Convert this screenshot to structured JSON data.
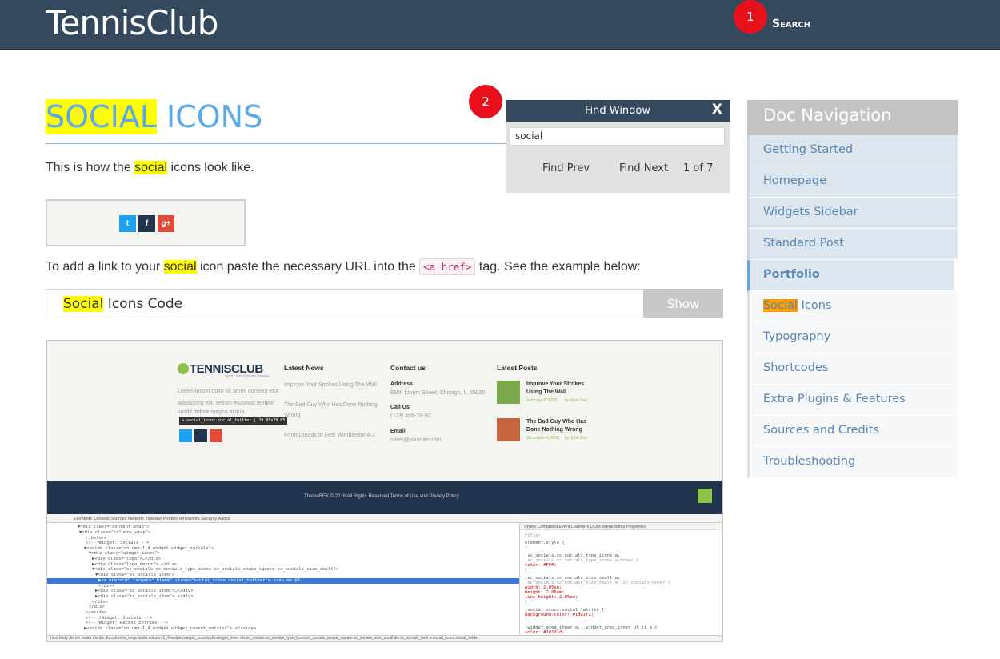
{
  "header": {
    "logo": "TennisClub",
    "search_label": "Search",
    "marker_1": "1",
    "marker_2": "2"
  },
  "content": {
    "title_highlight": "SOCIAL",
    "title_rest": " ICONS",
    "intro_before": "This is how the ",
    "intro_highlight": "social",
    "intro_after": " icons look like.",
    "para_before": "To add a link to your ",
    "para_highlight": "social",
    "para_middle": " icon paste the necessary URL into the ",
    "para_code": "<a href>",
    "para_after": " tag. See the example below:",
    "code_bar_highlight": "Social",
    "code_bar_rest": " Icons Code",
    "show_button": "Show"
  },
  "find_window": {
    "title": "Find Window",
    "close": "X",
    "query": "social",
    "prev": "Find Prev",
    "next": "Find Next",
    "count": "1 of 7"
  },
  "doc_nav": {
    "title": "Doc Navigation",
    "items": [
      {
        "label": "Getting Started"
      },
      {
        "label": "Homepage"
      },
      {
        "label": "Widgets Sidebar"
      },
      {
        "label": "Standard Post"
      },
      {
        "label": "Portfolio"
      },
      {
        "label_highlight": "Social",
        "label_rest": " Icons"
      },
      {
        "label": "Typography"
      },
      {
        "label": "Shortcodes"
      },
      {
        "label": "Extra Plugins & Features"
      },
      {
        "label": "Sources and Credits"
      },
      {
        "label": "Troubleshooting"
      }
    ]
  },
  "social_icons": {
    "twitter": "t",
    "facebook": "f",
    "google": "g+",
    "colors": {
      "twitter": "#1da1f2",
      "facebook": "#23344f",
      "google": "#e24a3a"
    }
  },
  "screenshot": {
    "logo": "TENNISCLUB",
    "logo_sub": "sport wordpress theme",
    "lorem": [
      "Lorem ipsum dolor sit amet, consect etur",
      "adipisicing elit, sed do eiusmod tempor",
      "incidit dolore magna aliqua."
    ],
    "tooltip": "a.social_icons.social_twitter | 29.05×29.05",
    "latest_news_title": "Latest News",
    "latest_news": [
      "Improve Your Strokes Using The Wall",
      "The Bad Guy Who Has Done Nothing",
      "Wrong",
      "From Dreads to Fed: Wimbledon A-Z"
    ],
    "contact_title": "Contact us",
    "address_label": "Address",
    "address": "8500 Lorem Street, Chicago, IL 55030",
    "call_label": "Call Us",
    "phone": "(123) 456-78-90",
    "email_label": "Email",
    "email": "sales@yoursite.com",
    "latest_posts_title": "Latest Posts",
    "post1_title": [
      "Improve Your Strokes",
      "Using The Wall"
    ],
    "post1_meta": "February 6, 2016",
    "post1_author": "by John Doe",
    "post2_title": [
      "The Bad Guy Who Has",
      "Done Nothing Wrong"
    ],
    "post2_meta": "December 4, 2015",
    "post2_author": "by John Doe",
    "footer_text": "ThemeREX © 2016 All Rights Reserved Terms of Use and Privacy Policy",
    "devtools_tabs": "Elements  Console  Sources  Network  Timeline  Profiles  Resources  Security  Audits",
    "devtools_lines": [
      "▼<div class=\"content_wrap\">",
      "▼<div class=\"columns_wrap\">",
      "::before",
      "<!-- Widget: Socials -->",
      "▼<aside class=\"column-1_4 widget widget_socials\">",
      "▼<div class=\"widget_inner\">",
      "▶<div class=\"logo\">…</div>",
      "▶<div class=\"logo_descr\">…</div>",
      "▼<div class=\"sc_socials sc_socials_type_icons sc_socials_shape_square sc_socials_size_small\">",
      "▼<div class=\"sc_socials_item\">",
      "▶<a href=\"#\" target=\"_blank\" class=\"social_icons social_twitter\">…</a> == $0",
      "</div>",
      "▶<div class=\"sc_socials_item\">…</div>",
      "▶<div class=\"sc_socials_item\">…</div>",
      "</div>",
      "</div>",
      "</aside>",
      "<!-- /Widget: Socials -->",
      "<!-- Widget: Recent Entries -->",
      "▶<aside class=\"column-1_4 widget widget_recent_entries\">…</aside>",
      "<!-- /Widget: Recent Entries -->"
    ],
    "styles_tabs": "Styles  Computed  Event Listeners  DOM Breakpoints  Properties",
    "styles_lines": [
      "Filter",
      "element.style {",
      "}",
      ".sc_socials.sc_socials_type_icons a,",
      ".sc_socials.sc_socials_type_icons a:hover {",
      "  color: #FFF;",
      "}",
      ".sc_socials.sc_socials_size_small a,",
      ".sc_socials.sc_socials_size_small a .sc_socials_hover {",
      "  width: 2.05em;",
      "  height: 2.05em;",
      "  line-height: 2.05em;",
      "}",
      ".social_icons.social_twitter {",
      "  background-color: #1da1f2;",
      "}",
      ".widget_area_inner a, .widget_area_inner ul li a {",
      "  color: #1d1d1d;"
    ],
    "breadcrumb": "html  body  div  div  footer  div  div  div.columns_wrap  aside.column-1_4.widget.widget_socials  div.widget_inner  div.sc_socials.sc_socials_type_icons.sc_socials_shape_square.sc_socials_size_small  div.sc_socials_item  a.social_icons.social_twitter"
  }
}
